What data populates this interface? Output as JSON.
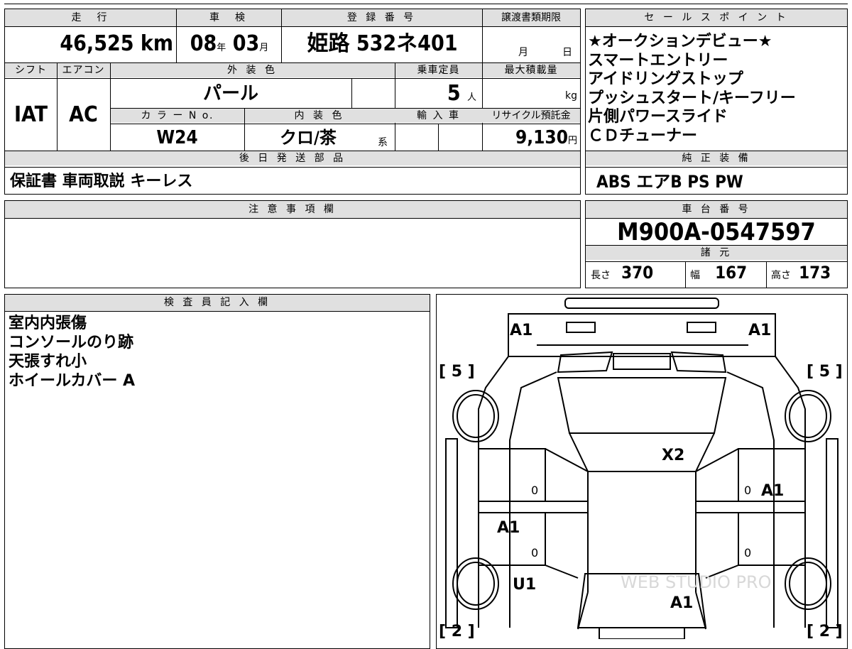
{
  "headers": {
    "mileage": "走　行",
    "inspection": "車　検",
    "registration": "登 録 番 号",
    "transfer_docs": "譲渡書類期限",
    "shift": "シフト",
    "aircon": "エアコン",
    "exterior_color": "外 装 色",
    "capacity": "乗車定員",
    "max_load": "最大積載量",
    "color_no": "カ ラ ー N o.",
    "interior_color": "内 装 色",
    "import": "輸 入 車",
    "recycle_fee": "リサイクル預託金",
    "later_parts": "後 日 発 送 部 品",
    "notes": "注 意 事 項 欄",
    "inspector": "検 査 員 記 入 欄",
    "sales_points": "セ ー ル ス ポ イ ン ト",
    "factory_equipment": "純 正 装 備",
    "chassis_no": "車 台 番 号",
    "specs": "諸 元"
  },
  "vehicle": {
    "mileage_value": "46,525",
    "mileage_unit": "km",
    "inspection_year": "08",
    "year_unit": "年",
    "inspection_month": "03",
    "month_unit": "月",
    "registration_no": "姫路 532ネ401",
    "transfer_month_unit": "月",
    "transfer_day_unit": "日",
    "shift": "IAT",
    "aircon": "AC",
    "exterior_color": "パール",
    "capacity": "5",
    "capacity_unit": "人",
    "max_load_unit": "kg",
    "color_no": "W24",
    "interior_color": "クロ/茶",
    "interior_suffix": "系",
    "recycle_fee": "9,130",
    "recycle_unit": "円"
  },
  "later_parts": "保証書 車両取説 キーレス",
  "sales_points": [
    "★オークションデビュー★",
    "スマートエントリー",
    "アイドリングストップ",
    "プッシュスタート/キーフリー",
    "片側パワースライド",
    "ＣＤチューナー"
  ],
  "factory_equipment": "ABS エアB PS PW",
  "chassis_no": "M900A-0547597",
  "specs": {
    "length_label": "長さ",
    "length": "370",
    "width_label": "幅",
    "width": "167",
    "height_label": "高さ",
    "height": "173"
  },
  "inspector_notes": [
    "室内内張傷",
    "コンソールのり跡",
    "天張すれ小",
    "ホイールカバー A"
  ],
  "damage_marks": {
    "front_left": "A1",
    "front_right": "A1",
    "roof": "X2",
    "right_front_door": "A1",
    "left_rear_door": "A1",
    "left_rear_fender": "U1",
    "rear": "A1",
    "tire_fl": "[ 5 ]",
    "tire_fr": "[ 5 ]",
    "tire_rl": "[ 2 ]",
    "tire_rr": "[ 2 ]",
    "door_zero": "0"
  },
  "watermark": "WEB STUDIO PRO"
}
